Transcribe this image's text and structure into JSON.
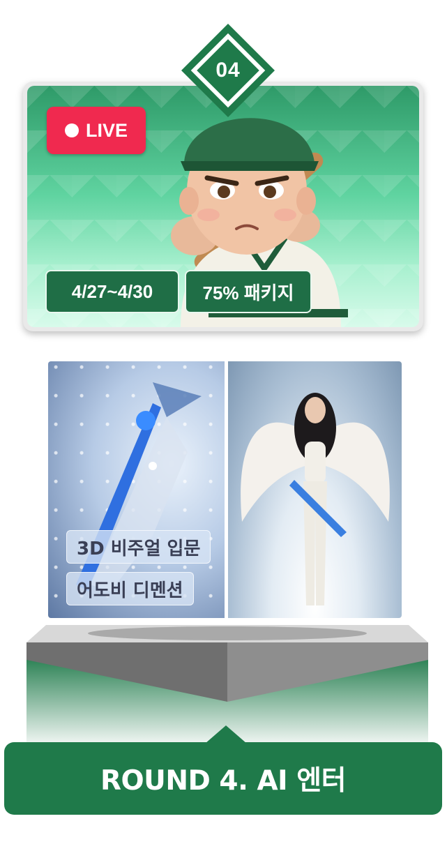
{
  "round_number": "04",
  "live_card": {
    "live_label": "LIVE",
    "date_range": "4/27~4/30",
    "package_label": "75% 패키지"
  },
  "course_tags": [
    "3D 비주얼 입문",
    "어도비 디멘션"
  ],
  "banner": {
    "title": "ROUND 4. AI 엔터"
  },
  "colors": {
    "brand_green": "#1f7a4a",
    "live_red": "#f0294f",
    "chip_green": "#1f6e46"
  }
}
